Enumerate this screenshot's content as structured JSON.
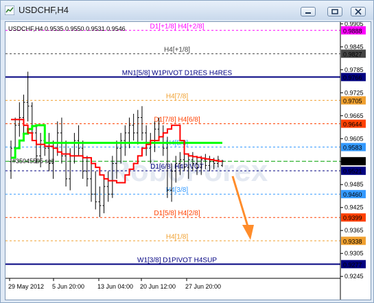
{
  "window": {
    "title": "USDCHF,H4",
    "buttons": [
      "minimize",
      "restore",
      "close"
    ]
  },
  "chart": {
    "header": "USDCHF,H4  0.9535 0.9550 0.9531 0.9546",
    "watermark": "RoboForex",
    "order_label": "#35045595 sell",
    "colors": {
      "background": "#ffffff",
      "price_bars": "#000000",
      "red_line": "#ff0000",
      "green_line": "#00ff00",
      "arrow": "#ff8c2a"
    }
  },
  "chart_data": {
    "type": "ohlc",
    "ylim": [
      0.924,
      0.991
    ],
    "y_ticks": [
      "0.9905",
      "0.9845",
      "0.9785",
      "0.9725",
      "0.9665",
      "0.9605",
      "0.9545",
      "0.9485",
      "0.9425",
      "0.9365",
      "0.9305",
      "0.9245"
    ],
    "x_ticks": [
      "29 May 2012",
      "5 Jun 20:00",
      "13 Jun 04:00",
      "20 Jun 12:00",
      "27 Jun 20:00"
    ],
    "levels": [
      {
        "label": "D1[+1/8] H4[+2/8]",
        "price": "0.9888",
        "color": "#ff00ff",
        "box": "#ff00ff",
        "style": "dash"
      },
      {
        "label": "H4[+1/8]",
        "price": "0.9827",
        "color": "#444444",
        "box": "#444444",
        "style": "dash"
      },
      {
        "label": "MN1[5/8] W1PIVOT D1RES H4RES",
        "price": "0.9766",
        "color": "#000080",
        "box": "#000080",
        "style": "solid"
      },
      {
        "label": "H4[7/8]",
        "price": "0.9705",
        "color": "#f0a030",
        "box": "#f0a030",
        "style": "dash"
      },
      {
        "label": "D1[7/8] H4[6/8]",
        "price": "0.9644",
        "color": "#ff4000",
        "box": "#ff4000",
        "style": "dash"
      },
      {
        "label": "H4[5/8]",
        "price": "0.9583",
        "color": "#3399ff",
        "box": "#3399ff",
        "style": "dash"
      },
      {
        "label": "D1[6/8] H4PIVOT",
        "price": "0.9521",
        "color": "#000080",
        "box": "#000080",
        "style": "dash"
      },
      {
        "label": "H4[3/8]",
        "price": "0.9460",
        "color": "#3399ff",
        "box": "#3399ff",
        "style": "dash"
      },
      {
        "label": "D1[5/8] H4[2/8]",
        "price": "0.9399",
        "color": "#ff4000",
        "box": "#ff4000",
        "style": "dash"
      },
      {
        "label": "H4[1/8]",
        "price": "0.9338",
        "color": "#f0a030",
        "box": "#f0a030",
        "style": "dash"
      },
      {
        "label": "W1[3/8] D1PIVOT H4SUP",
        "price": "0.9277",
        "color": "#000080",
        "box": "#000080",
        "style": "solid"
      }
    ],
    "current_price": "0.9546",
    "order_line_price": "0.9546",
    "green_ma": [
      0.9555,
      0.958,
      0.96,
      0.9618,
      0.963,
      0.9638,
      0.964,
      0.964,
      0.9594,
      0.9594,
      0.9594,
      0.9594,
      0.9594,
      0.9594,
      0.9594,
      0.9594,
      0.9594,
      0.9594,
      0.9594,
      0.9594,
      0.9594,
      0.9594,
      0.9594,
      0.9594,
      0.9594,
      0.9594,
      0.9594,
      0.9594,
      0.9594,
      0.9594,
      0.9594,
      0.9594,
      0.9594,
      0.9594,
      0.9594,
      0.9594,
      0.9594,
      0.9594,
      0.9594,
      0.9594,
      0.9594,
      0.9594,
      0.9594,
      0.9594,
      0.9594,
      0.9594,
      0.9594,
      0.9594,
      0.9594,
      0.9594,
      0.9594
    ],
    "red_ma": [
      0.9655,
      0.9655,
      0.9655,
      0.964,
      0.962,
      0.96,
      0.959,
      0.959,
      0.9585,
      0.9585,
      0.958,
      0.957,
      0.9565,
      0.9565,
      0.956,
      0.956,
      0.956,
      0.9555,
      0.9555,
      0.954,
      0.953,
      0.951,
      0.95,
      0.9495,
      0.9495,
      0.949,
      0.949,
      0.951,
      0.9525,
      0.954,
      0.956,
      0.958,
      0.959,
      0.96,
      0.96,
      0.961,
      0.962,
      0.963,
      0.964,
      0.964,
      0.96,
      0.9565,
      0.956,
      0.9558,
      0.9556,
      0.9554,
      0.9552,
      0.955,
      0.9548,
      0.9546,
      0.9546
    ],
    "ohlc": [
      [
        0.9545,
        0.96,
        0.95,
        0.958
      ],
      [
        0.958,
        0.966,
        0.956,
        0.964
      ],
      [
        0.964,
        0.97,
        0.961,
        0.966
      ],
      [
        0.966,
        0.972,
        0.962,
        0.97
      ],
      [
        0.97,
        0.978,
        0.965,
        0.969
      ],
      [
        0.969,
        0.97,
        0.96,
        0.962
      ],
      [
        0.962,
        0.964,
        0.954,
        0.956
      ],
      [
        0.956,
        0.962,
        0.953,
        0.96
      ],
      [
        0.96,
        0.964,
        0.956,
        0.958
      ],
      [
        0.958,
        0.962,
        0.952,
        0.954
      ],
      [
        0.954,
        0.96,
        0.95,
        0.958
      ],
      [
        0.958,
        0.965,
        0.956,
        0.962
      ],
      [
        0.962,
        0.966,
        0.954,
        0.956
      ],
      [
        0.956,
        0.96,
        0.948,
        0.95
      ],
      [
        0.95,
        0.958,
        0.947,
        0.956
      ],
      [
        0.956,
        0.962,
        0.954,
        0.96
      ],
      [
        0.96,
        0.964,
        0.956,
        0.958
      ],
      [
        0.958,
        0.96,
        0.95,
        0.952
      ],
      [
        0.952,
        0.956,
        0.948,
        0.95
      ],
      [
        0.95,
        0.954,
        0.944,
        0.946
      ],
      [
        0.946,
        0.952,
        0.942,
        0.944
      ],
      [
        0.944,
        0.948,
        0.94,
        0.943
      ],
      [
        0.943,
        0.95,
        0.941,
        0.948
      ],
      [
        0.948,
        0.952,
        0.944,
        0.946
      ],
      [
        0.946,
        0.956,
        0.945,
        0.954
      ],
      [
        0.954,
        0.96,
        0.95,
        0.958
      ],
      [
        0.958,
        0.962,
        0.954,
        0.96
      ],
      [
        0.96,
        0.964,
        0.956,
        0.962
      ],
      [
        0.962,
        0.966,
        0.958,
        0.964
      ],
      [
        0.964,
        0.967,
        0.96,
        0.962
      ],
      [
        0.962,
        0.968,
        0.959,
        0.966
      ],
      [
        0.966,
        0.969,
        0.96,
        0.962
      ],
      [
        0.962,
        0.964,
        0.956,
        0.958
      ],
      [
        0.958,
        0.962,
        0.954,
        0.96
      ],
      [
        0.96,
        0.965,
        0.957,
        0.963
      ],
      [
        0.963,
        0.966,
        0.96,
        0.961
      ],
      [
        0.961,
        0.964,
        0.956,
        0.958
      ],
      [
        0.958,
        0.961,
        0.945,
        0.947
      ],
      [
        0.947,
        0.954,
        0.944,
        0.952
      ],
      [
        0.952,
        0.956,
        0.949,
        0.954
      ],
      [
        0.954,
        0.957,
        0.951,
        0.955
      ],
      [
        0.955,
        0.957,
        0.952,
        0.953
      ],
      [
        0.953,
        0.956,
        0.95,
        0.955
      ],
      [
        0.955,
        0.957,
        0.952,
        0.954
      ],
      [
        0.954,
        0.956,
        0.951,
        0.953
      ],
      [
        0.953,
        0.956,
        0.951,
        0.955
      ],
      [
        0.955,
        0.9565,
        0.9525,
        0.9535
      ],
      [
        0.9535,
        0.956,
        0.952,
        0.9545
      ],
      [
        0.9545,
        0.9555,
        0.9525,
        0.954
      ],
      [
        0.954,
        0.956,
        0.953,
        0.955
      ],
      [
        0.9535,
        0.955,
        0.9531,
        0.9546
      ]
    ]
  }
}
